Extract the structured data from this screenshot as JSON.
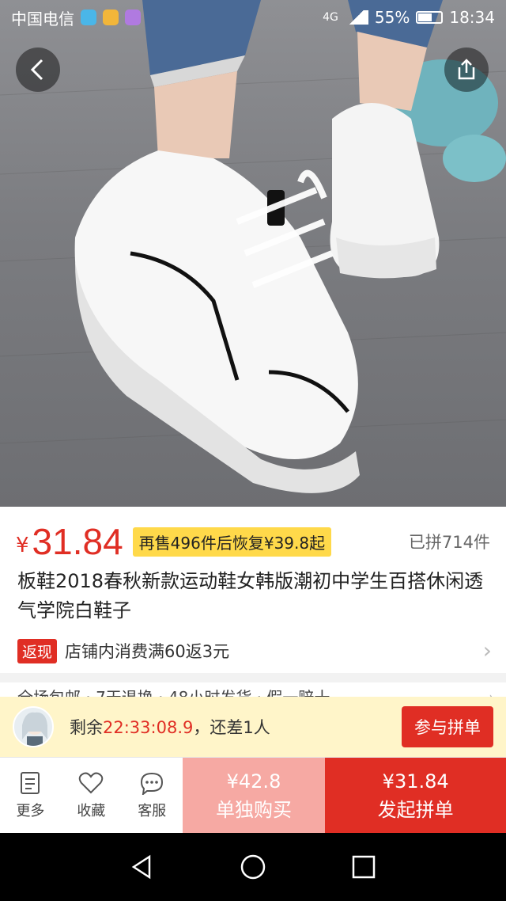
{
  "status_bar": {
    "carrier": "中国电信",
    "network": "4G",
    "battery": "55%",
    "time": "18:34"
  },
  "nav": {
    "back_icon": "chevron-left-icon",
    "share_icon": "share-icon"
  },
  "product": {
    "currency": "¥",
    "price": "31.84",
    "promo": "再售496件后恢复¥39.8起",
    "sold": "已拼714件",
    "title": "板鞋2018春秋新款运动鞋女韩版潮初中学生百搭休闲透气学院白鞋子"
  },
  "rebate": {
    "tag": "返现",
    "text": "店铺内消费满60返3元"
  },
  "services": {
    "text": "全场包邮 · 7天退换 · 48小时发货 · 假一赔十"
  },
  "group": {
    "remain_prefix": "剩余",
    "countdown": "22:33:08.9",
    "remain_suffix": "，还差1人",
    "join_label": "参与拼单"
  },
  "bottom_bar": {
    "more": "更多",
    "favorite": "收藏",
    "service": "客服",
    "alone_price": "¥42.8",
    "alone_label": "单独购买",
    "group_price": "¥31.84",
    "group_label": "发起拼单"
  },
  "colors": {
    "accent": "#e02e24",
    "promo_bg": "#ffd94a",
    "group_bar_bg": "#fff5c9",
    "alone_bg": "#f6a9a3"
  }
}
